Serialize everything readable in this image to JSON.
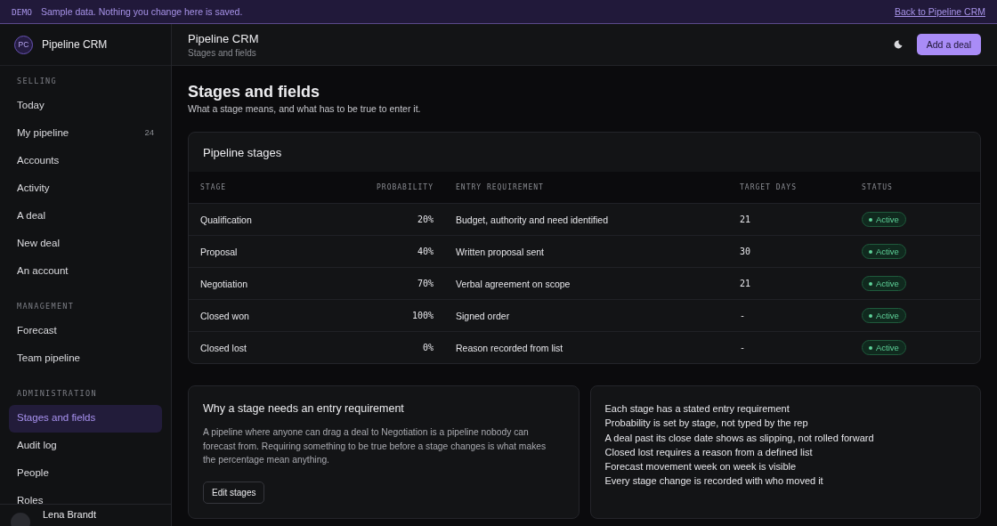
{
  "banner": {
    "tag": "DEMO",
    "message": "Sample data. Nothing you change here is saved.",
    "link": "Back to Pipeline CRM"
  },
  "brand": {
    "initials": "PC",
    "name": "Pipeline CRM"
  },
  "sidebar": {
    "sections": [
      {
        "title": "SELLING",
        "items": [
          {
            "label": "Today",
            "selected": false
          },
          {
            "label": "My pipeline",
            "count": "24",
            "selected": false
          },
          {
            "label": "Accounts",
            "selected": false
          },
          {
            "label": "Activity",
            "selected": false
          },
          {
            "label": "A deal",
            "selected": false
          },
          {
            "label": "New deal",
            "selected": false
          },
          {
            "label": "An account",
            "selected": false
          }
        ]
      },
      {
        "title": "MANAGEMENT",
        "items": [
          {
            "label": "Forecast",
            "selected": false
          },
          {
            "label": "Team pipeline",
            "selected": false
          }
        ]
      },
      {
        "title": "ADMINISTRATION",
        "items": [
          {
            "label": "Stages and fields",
            "selected": true
          },
          {
            "label": "Audit log",
            "selected": false
          },
          {
            "label": "People",
            "selected": false
          },
          {
            "label": "Roles",
            "selected": false
          }
        ]
      }
    ],
    "user": {
      "name": "Lena Brandt"
    }
  },
  "header": {
    "title": "Pipeline CRM",
    "subtitle": "Stages and fields",
    "primary_button": "Add a deal"
  },
  "page": {
    "title": "Stages and fields",
    "subtitle": "What a stage means, and what has to be true to enter it."
  },
  "table": {
    "title": "Pipeline stages",
    "columns": [
      "STAGE",
      "PROBABILITY",
      "ENTRY REQUIREMENT",
      "TARGET DAYS",
      "STATUS"
    ],
    "rows": [
      {
        "stage": "Qualification",
        "probability": "20%",
        "requirement": "Budget, authority and need identified",
        "target_days": "21",
        "status": "Active"
      },
      {
        "stage": "Proposal",
        "probability": "40%",
        "requirement": "Written proposal sent",
        "target_days": "30",
        "status": "Active"
      },
      {
        "stage": "Negotiation",
        "probability": "70%",
        "requirement": "Verbal agreement on scope",
        "target_days": "21",
        "status": "Active"
      },
      {
        "stage": "Closed won",
        "probability": "100%",
        "requirement": "Signed order",
        "target_days": "-",
        "status": "Active"
      },
      {
        "stage": "Closed lost",
        "probability": "0%",
        "requirement": "Reason recorded from list",
        "target_days": "-",
        "status": "Active"
      }
    ]
  },
  "explainer": {
    "title": "Why a stage needs an entry requirement",
    "body": "A pipeline where anyone can drag a deal to Negotiation is a pipeline nobody can forecast from. Requiring something to be true before a stage changes is what makes the percentage mean anything.",
    "button": "Edit stages"
  },
  "rules": [
    "Each stage has a stated entry requirement",
    "Probability is set by stage, not typed by the rep",
    "A deal past its close date shows as slipping, not rolled forward",
    "Closed lost requires a reason from a defined list",
    "Forecast movement week on week is visible",
    "Every stage change is recorded with who moved it"
  ]
}
